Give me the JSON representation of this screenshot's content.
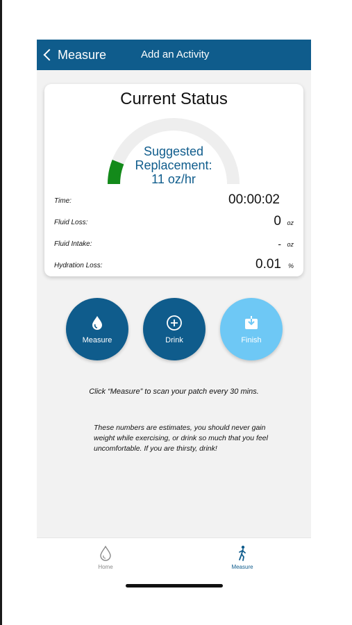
{
  "nav": {
    "back_label": "Measure",
    "title": "Add an Activity"
  },
  "status_card": {
    "title": "Current Status",
    "suggestion_line1": "Suggested",
    "suggestion_line2": "Replacement:",
    "suggestion_value": "11 oz/hr",
    "gauge_fill_fraction": 0.12,
    "gauge_color": "#138a1a",
    "rows": [
      {
        "label": "Time:",
        "value": "00:00:02",
        "unit": ""
      },
      {
        "label": "Fluid Loss:",
        "value": "0",
        "unit": "oz"
      },
      {
        "label": "Fluid Intake:",
        "value": "-",
        "unit": "oz"
      },
      {
        "label": "Hydration Loss:",
        "value": "0.01",
        "unit": "%"
      }
    ]
  },
  "actions": {
    "measure": {
      "label": "Measure",
      "icon": "water-drop-icon",
      "color": "#0f5c8c"
    },
    "drink": {
      "label": "Drink",
      "icon": "plus-circle-icon",
      "color": "#0f5c8c"
    },
    "finish": {
      "label": "Finish",
      "icon": "download-tray-icon",
      "color": "#6ec8f5"
    }
  },
  "hint_text": "Click “Measure” to scan your patch every 30 mins.",
  "disclaimer_text": "These numbers are estimates, you should never gain weight while exercising, or drink so much that you feel uncomfortable. If you are thirsty, drink!",
  "tabbar": {
    "home": {
      "label": "Home",
      "icon": "water-drop-outline-icon"
    },
    "measure": {
      "label": "Measure",
      "icon": "walking-person-icon",
      "active": true
    }
  },
  "colors": {
    "primary": "#0f5c8c",
    "accent_light": "#6ec8f5",
    "gauge_track": "#eeeeee",
    "gauge_fill": "#138a1a"
  }
}
